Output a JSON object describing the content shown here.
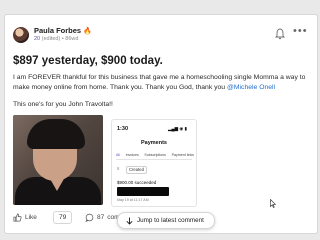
{
  "post": {
    "author": "Paula Forbes",
    "author_badge": "🔥",
    "level": "20",
    "level_suffix": "(edited) • 86wd",
    "title": "$897 yesterday, $900 today.",
    "body_main": "I am FOREVER thankful for this business that gave me a homeschooling single Momma a way to make money online from home. Thank you. Thank you God, thank you ",
    "mention": "@Michele Onell",
    "body_dedication": "This one's for you John Travolta!!",
    "images": {
      "photo_alt": "photo",
      "screenshot": {
        "time": "1:30",
        "status_icons": "▂▄▆ ◉ ▮",
        "title": "Payments",
        "tabs": [
          "All",
          "Invoices",
          "Subscriptions",
          "Payment links"
        ],
        "filter_label": "≡",
        "chip_label": "Created",
        "amount": "$900.00 succeeded",
        "date": "May 19 at 11:17 AM"
      }
    }
  },
  "footer": {
    "like_label": "Like",
    "like_count": "79",
    "comment_count": "87",
    "comment_label": "comme",
    "jump_label": "Jump to latest comment"
  },
  "icons": {
    "bell": "bell-icon",
    "more": "more-options-icon",
    "like": "thumbs-up-icon",
    "comment": "comment-icon",
    "jump": "arrow-down-icon"
  },
  "colors": {
    "mention": "#1f6fd1",
    "badge": "#e8772a"
  }
}
